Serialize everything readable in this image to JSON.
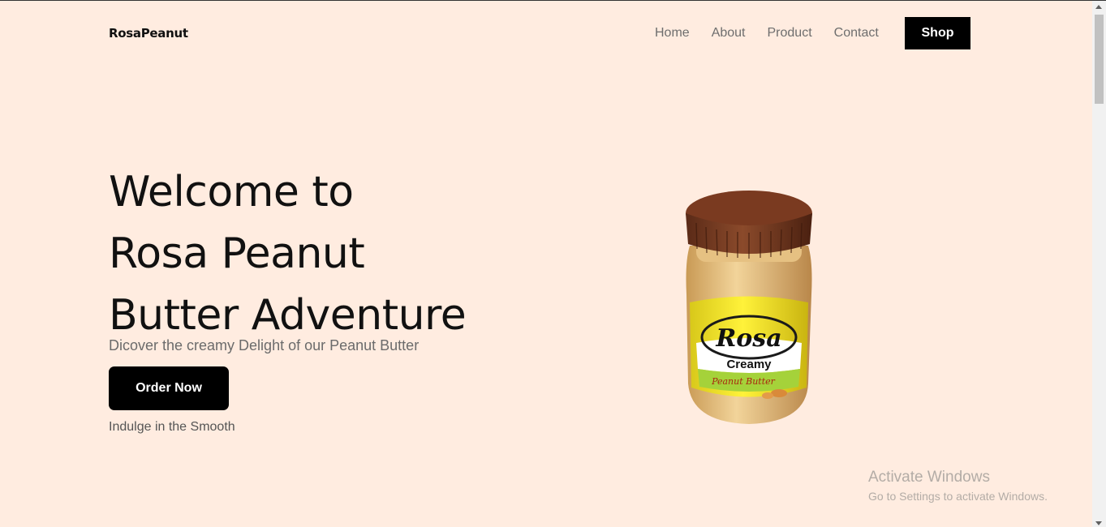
{
  "header": {
    "logo": "RosaPeanut",
    "nav": [
      "Home",
      "About",
      "Product",
      "Contact"
    ],
    "shop_label": "Shop"
  },
  "hero": {
    "title_lines": [
      "Welcome to",
      "Rosa Peanut",
      "Butter Adventure"
    ],
    "subtitle": "Dicover the creamy Delight of our Peanut Butter",
    "order_label": "Order Now",
    "tagline": "Indulge in the Smooth",
    "jar_label": {
      "brand": "Rosa",
      "variant": "Creamy",
      "product": "Peanut Butter"
    }
  },
  "watermark": {
    "title": "Activate Windows",
    "subtitle": "Go to Settings to activate Windows."
  },
  "colors": {
    "background": "#ffece0",
    "button": "#000000",
    "nav_text": "#6e6e6e"
  }
}
